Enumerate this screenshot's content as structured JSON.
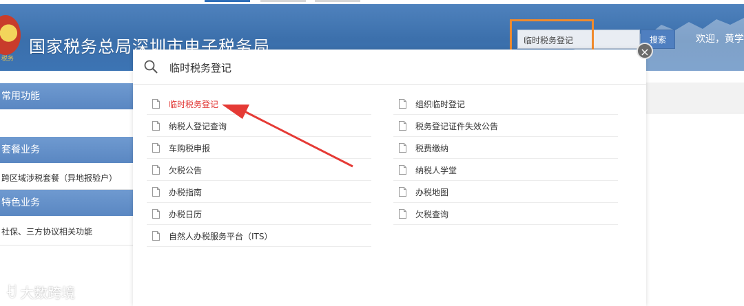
{
  "header": {
    "site_title": "国家税务总局深圳市电子税务局",
    "emblem_text": "税务",
    "search_value": "临时税务登记",
    "search_button": "搜索",
    "welcome": "欢迎，黄学"
  },
  "sidebar": {
    "sections": [
      {
        "title": "常用功能",
        "items": []
      },
      {
        "title": "套餐业务",
        "items": [
          "跨区域涉税套餐（异地报验户）"
        ]
      },
      {
        "title": "特色业务",
        "items": [
          "社保、三方协议相关功能"
        ]
      }
    ]
  },
  "modal": {
    "query": "临时税务登记",
    "results_left": [
      "临时税务登记",
      "纳税人登记查询",
      "车购税申报",
      "欠税公告",
      "办税指南",
      "办税日历",
      "自然人办税服务平台（ITS）"
    ],
    "results_right": [
      "组织临时登记",
      "税务登记证件失效公告",
      "税费缴纳",
      "纳税人学堂",
      "办税地图",
      "欠税查询"
    ],
    "active_result": "临时税务登记",
    "close": "×"
  },
  "watermark": {
    "text": "大数跨境",
    "logo": "ꀀ"
  },
  "colors": {
    "active_result": "#e0302d",
    "highlight_box": "#f08a2c",
    "banner": "#3b6fab",
    "arrow": "#e53a35"
  },
  "icons": {
    "search": "magnifier-icon",
    "close": "close-icon",
    "result": "document-icon"
  }
}
